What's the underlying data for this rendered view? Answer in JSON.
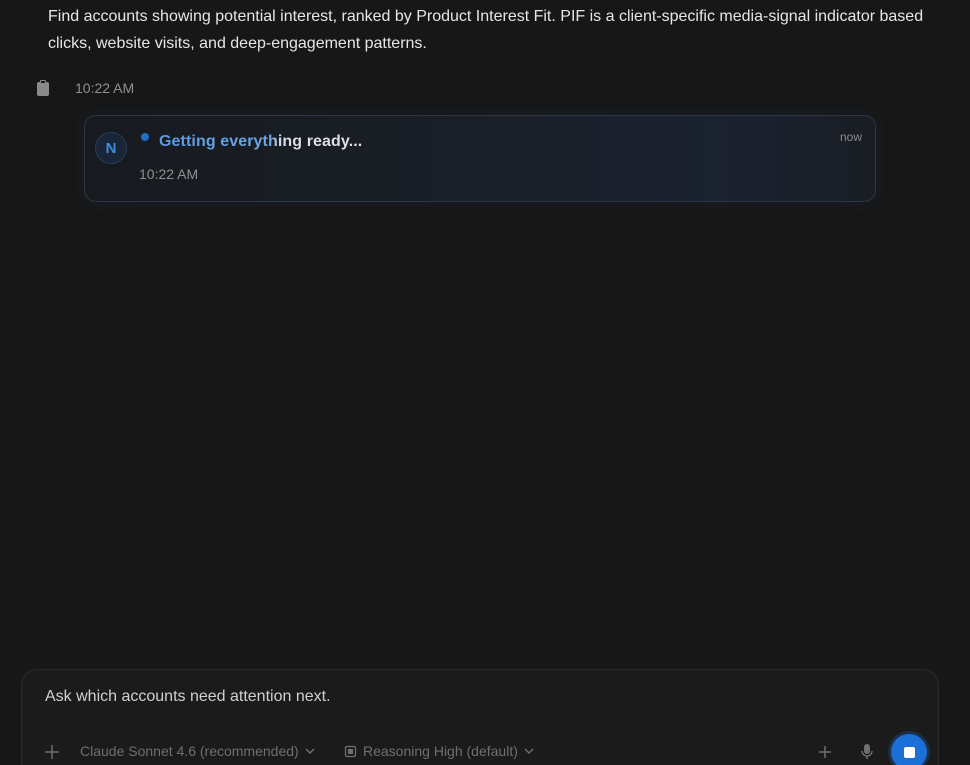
{
  "conversation": {
    "user_message": {
      "line1": "Find accounts showing potential interest, ranked by Product Interest Fit. PIF is a client-specific media-signal indicator based",
      "line2": "clicks, website visits, and deep-engagement patterns."
    },
    "message_time": "10:22 AM"
  },
  "status_card": {
    "avatar_letter": "N",
    "title": "Getting everything ready...",
    "relative_time": "now",
    "time": "10:22 AM",
    "accent_color": "#1f6fc4"
  },
  "composer": {
    "placeholder": "Ask which accounts need attention next.",
    "model_label": "Claude Sonnet 4.6 (recommended)",
    "reasoning_label": "Reasoning High (default)",
    "icons": {
      "attach": "plus-icon",
      "add": "plus-icon",
      "mic": "microphone-icon",
      "stop": "stop-icon"
    },
    "stop_color": "#1d6fd8"
  }
}
